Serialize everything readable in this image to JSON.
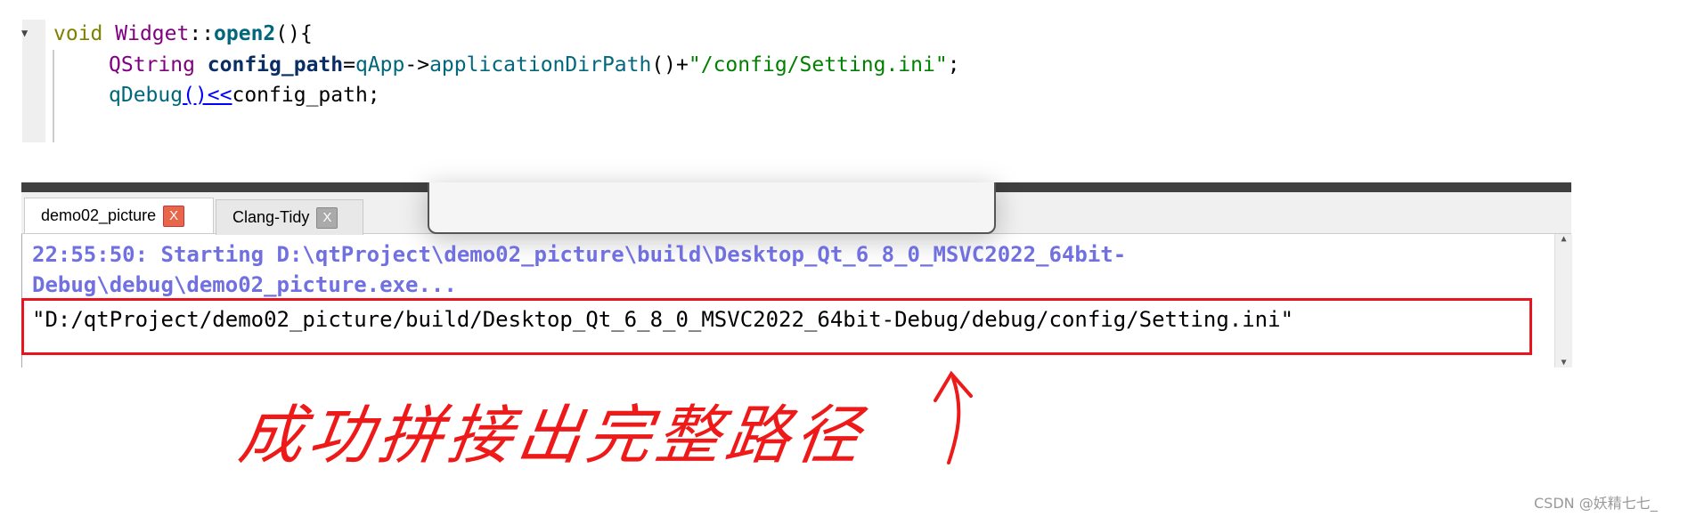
{
  "code": {
    "line1": {
      "kw": "void",
      "cls": "Widget",
      "sep": "::",
      "fn": "open2",
      "rest": "(){"
    },
    "line2": {
      "type": "QString",
      "var": "config_path",
      "eq": "=",
      "obj": "qApp",
      "arrow": "->",
      "call": "applicationDirPath",
      "paren": "()",
      "plus": "+",
      "str": "\"/config/Setting.ini\"",
      "semi": ";"
    },
    "line3": {
      "fn": "qDebug",
      "link": "()<<",
      "rest": "config_path;"
    }
  },
  "tabs": [
    {
      "label": "demo02_picture",
      "close": "X",
      "active": true
    },
    {
      "label": "Clang-Tidy",
      "close": "X",
      "active": false
    }
  ],
  "output": {
    "line1": "22:55:50: Starting D:\\qtProject\\demo02_picture\\build\\Desktop_Qt_6_8_0_MSVC2022_64bit-",
    "line2": "Debug\\debug\\demo02_picture.exe...",
    "line3": "\"D:/qtProject/demo02_picture/build/Desktop_Qt_6_8_0_MSVC2022_64bit-Debug/debug/config/Setting.ini\""
  },
  "annotation": {
    "text": "成功拼接出完整路径",
    "color": "#ee1a1a"
  },
  "watermark": "CSDN @妖精七七_"
}
